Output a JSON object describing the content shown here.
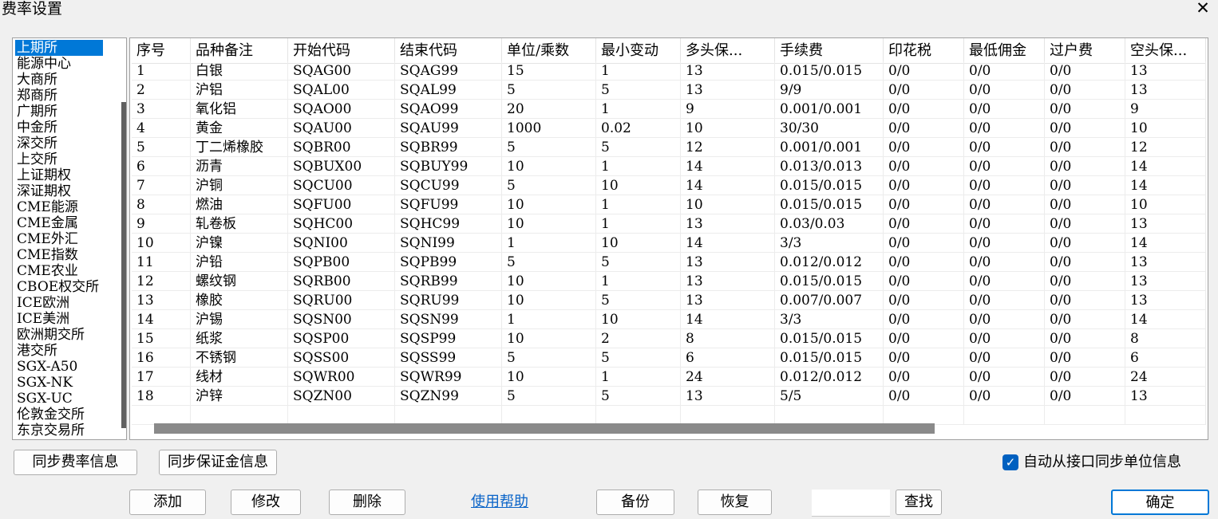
{
  "window": {
    "title": "费率设置",
    "close_glyph": "✕"
  },
  "exchanges": {
    "selected_index": 0,
    "items": [
      "上期所",
      "能源中心",
      "大商所",
      "郑商所",
      "广期所",
      "中金所",
      "深交所",
      "上交所",
      "上证期权",
      "深证期权",
      "CME能源",
      "CME金属",
      "CME外汇",
      "CME指数",
      "CME农业",
      "CBOE权交所",
      "ICE欧洲",
      "ICE美洲",
      "欧洲期交所",
      "港交所",
      "SGX-A50",
      "SGX-NK",
      "SGX-UC",
      "伦敦金交所",
      "东京交易所"
    ]
  },
  "table": {
    "columns": [
      "序号",
      "品种备注",
      "开始代码",
      "结束代码",
      "单位/乘数",
      "最小变动",
      "多头保...",
      "手续费",
      "印花税",
      "最低佣金",
      "过户费",
      "空头保..."
    ],
    "rows": [
      [
        "1",
        "白银",
        "SQAG00",
        "SQAG99",
        "15",
        "1",
        "13",
        "0.015/0.015",
        "0/0",
        "0/0",
        "0/0",
        "13"
      ],
      [
        "2",
        "沪铝",
        "SQAL00",
        "SQAL99",
        "5",
        "5",
        "13",
        "9/9",
        "0/0",
        "0/0",
        "0/0",
        "13"
      ],
      [
        "3",
        "氧化铝",
        "SQAO00",
        "SQAO99",
        "20",
        "1",
        "9",
        "0.001/0.001",
        "0/0",
        "0/0",
        "0/0",
        "9"
      ],
      [
        "4",
        "黄金",
        "SQAU00",
        "SQAU99",
        "1000",
        "0.02",
        "10",
        "30/30",
        "0/0",
        "0/0",
        "0/0",
        "10"
      ],
      [
        "5",
        "丁二烯橡胶",
        "SQBR00",
        "SQBR99",
        "5",
        "5",
        "12",
        "0.001/0.001",
        "0/0",
        "0/0",
        "0/0",
        "12"
      ],
      [
        "6",
        "沥青",
        "SQBUX00",
        "SQBUY99",
        "10",
        "1",
        "14",
        "0.013/0.013",
        "0/0",
        "0/0",
        "0/0",
        "14"
      ],
      [
        "7",
        "沪铜",
        "SQCU00",
        "SQCU99",
        "5",
        "10",
        "14",
        "0.015/0.015",
        "0/0",
        "0/0",
        "0/0",
        "14"
      ],
      [
        "8",
        "燃油",
        "SQFU00",
        "SQFU99",
        "10",
        "1",
        "10",
        "0.015/0.015",
        "0/0",
        "0/0",
        "0/0",
        "10"
      ],
      [
        "9",
        "轧卷板",
        "SQHC00",
        "SQHC99",
        "10",
        "1",
        "13",
        "0.03/0.03",
        "0/0",
        "0/0",
        "0/0",
        "13"
      ],
      [
        "10",
        "沪镍",
        "SQNI00",
        "SQNI99",
        "1",
        "10",
        "14",
        "3/3",
        "0/0",
        "0/0",
        "0/0",
        "14"
      ],
      [
        "11",
        "沪铅",
        "SQPB00",
        "SQPB99",
        "5",
        "5",
        "13",
        "0.012/0.012",
        "0/0",
        "0/0",
        "0/0",
        "13"
      ],
      [
        "12",
        "螺纹钢",
        "SQRB00",
        "SQRB99",
        "10",
        "1",
        "13",
        "0.015/0.015",
        "0/0",
        "0/0",
        "0/0",
        "13"
      ],
      [
        "13",
        "橡胶",
        "SQRU00",
        "SQRU99",
        "10",
        "5",
        "13",
        "0.007/0.007",
        "0/0",
        "0/0",
        "0/0",
        "13"
      ],
      [
        "14",
        "沪锡",
        "SQSN00",
        "SQSN99",
        "1",
        "10",
        "14",
        "3/3",
        "0/0",
        "0/0",
        "0/0",
        "14"
      ],
      [
        "15",
        "纸浆",
        "SQSP00",
        "SQSP99",
        "10",
        "2",
        "8",
        "0.015/0.015",
        "0/0",
        "0/0",
        "0/0",
        "8"
      ],
      [
        "16",
        "不锈钢",
        "SQSS00",
        "SQSS99",
        "5",
        "5",
        "6",
        "0.015/0.015",
        "0/0",
        "0/0",
        "0/0",
        "6"
      ],
      [
        "17",
        "线材",
        "SQWR00",
        "SQWR99",
        "10",
        "1",
        "24",
        "0.012/0.012",
        "0/0",
        "0/0",
        "0/0",
        "24"
      ],
      [
        "18",
        "沪锌",
        "SQZN00",
        "SQZN99",
        "5",
        "5",
        "13",
        "5/5",
        "0/0",
        "0/0",
        "0/0",
        "13"
      ]
    ]
  },
  "sync": {
    "rate_btn": "同步费率信息",
    "margin_btn": "同步保证金信息",
    "auto_sync_label": "自动从接口同步单位信息",
    "auto_sync_checked": true,
    "check_glyph": "✓"
  },
  "actions": {
    "add": "添加",
    "modify": "修改",
    "delete": "删除",
    "help": "使用帮助",
    "backup": "备份",
    "restore": "恢复",
    "search_value": "",
    "find": "查找",
    "ok": "确定"
  },
  "colors": {
    "selection": "#0078d7",
    "link": "#0a64c8",
    "checkbox": "#0060c0"
  }
}
